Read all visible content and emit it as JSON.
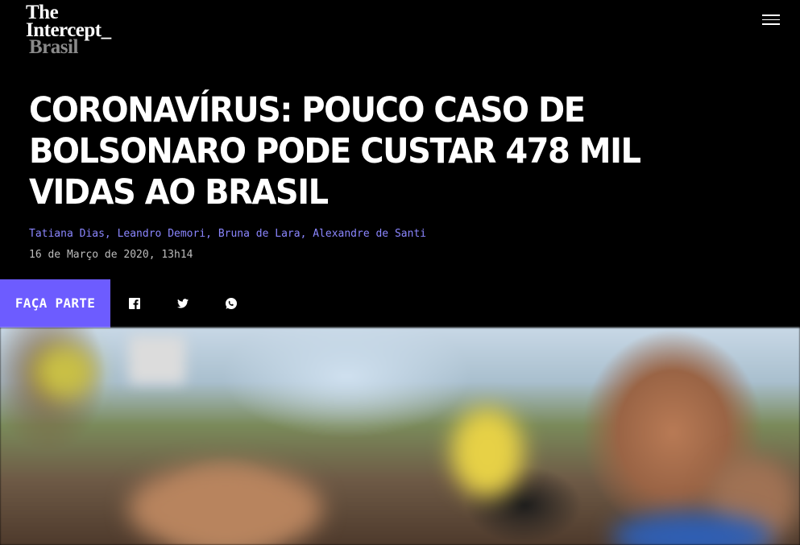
{
  "header": {
    "logo": {
      "line1": "The",
      "line2": "Intercept",
      "underscore": "_",
      "line3": "Brasil"
    },
    "menu_icon": "hamburger-menu-icon"
  },
  "article": {
    "headline": "CORONAVÍRUS: POUCO CASO DE BOLSONARO PODE CUSTAR 478 MIL VIDAS AO BRASIL",
    "authors": [
      "Tatiana Dias",
      "Leandro Demori",
      "Bruna de Lara",
      "Alexandre de Santi"
    ],
    "separator": ", ",
    "date": "16 de Março de 2020, 13h14"
  },
  "share_bar": {
    "cta_label": "FAÇA PARTE",
    "icons": [
      "facebook-icon",
      "twitter-icon",
      "whatsapp-icon"
    ]
  },
  "colors": {
    "accent": "#6d5cff",
    "author_link": "#8b86ff",
    "background": "#000000",
    "logo_subtitle": "#8a8a8a"
  }
}
